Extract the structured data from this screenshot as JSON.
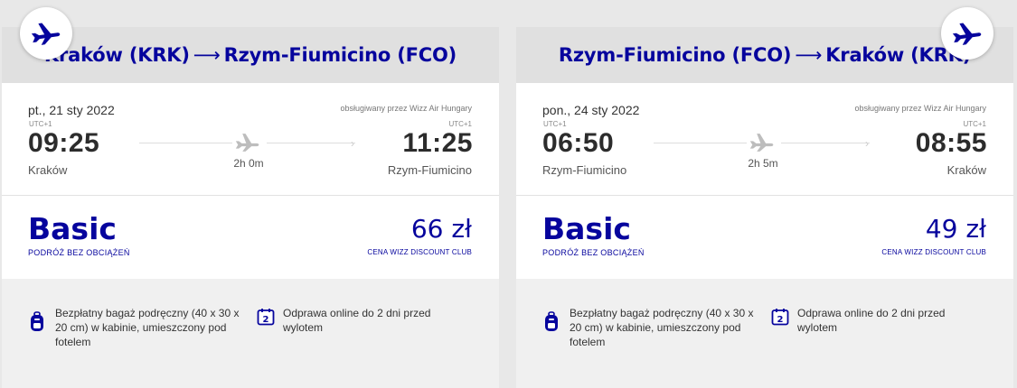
{
  "cards": [
    {
      "route": {
        "from": "Kraków (KRK)",
        "arrow": "⟶",
        "to": "Rzym-Fiumicino (FCO)"
      },
      "date": "pt., 21 sty 2022",
      "operator": "obsługiwany przez Wizz Air Hungary",
      "dep_tz": "UTC+1",
      "arr_tz": "UTC+1",
      "dep_time": "09:25",
      "arr_time": "11:25",
      "dep_city": "Kraków",
      "arr_city": "Rzym-Fiumicino",
      "duration": "2h 0m",
      "fare": "Basic",
      "fare_sub": "PODRÓŻ BEZ OBCIĄŻEŃ",
      "price": "66 zł",
      "price_sub": "CENA WIZZ DISCOUNT CLUB",
      "feature1": "Bezpłatny bagaż podręczny (40 x 30 x 20 cm) w kabinie, umieszczony pod fotelem",
      "feature2": "Odprawa online do 2 dni przed wylotem",
      "calendar_num": "2"
    },
    {
      "route": {
        "from": "Rzym-Fiumicino (FCO)",
        "arrow": "⟶",
        "to": "Kraków (KRK)"
      },
      "date": "pon., 24 sty 2022",
      "operator": "obsługiwany przez Wizz Air Hungary",
      "dep_tz": "UTC+1",
      "arr_tz": "UTC+1",
      "dep_time": "06:50",
      "arr_time": "08:55",
      "dep_city": "Rzym-Fiumicino",
      "arr_city": "Kraków",
      "duration": "2h 5m",
      "fare": "Basic",
      "fare_sub": "PODRÓŻ BEZ OBCIĄŻEŃ",
      "price": "49 zł",
      "price_sub": "CENA WIZZ DISCOUNT CLUB",
      "feature1": "Bezpłatny bagaż podręczny (40 x 30 x 20 cm) w kabinie, umieszczony pod fotelem",
      "feature2": "Odprawa online do 2 dni przed wylotem",
      "calendar_num": "2"
    }
  ],
  "colors": {
    "brand": "#06049d",
    "background": "#e8e8e8"
  },
  "icons": {
    "badge": "airplane-icon",
    "route_plane": "airplane-icon",
    "bag": "backpack-icon",
    "checkin": "calendar-icon"
  }
}
